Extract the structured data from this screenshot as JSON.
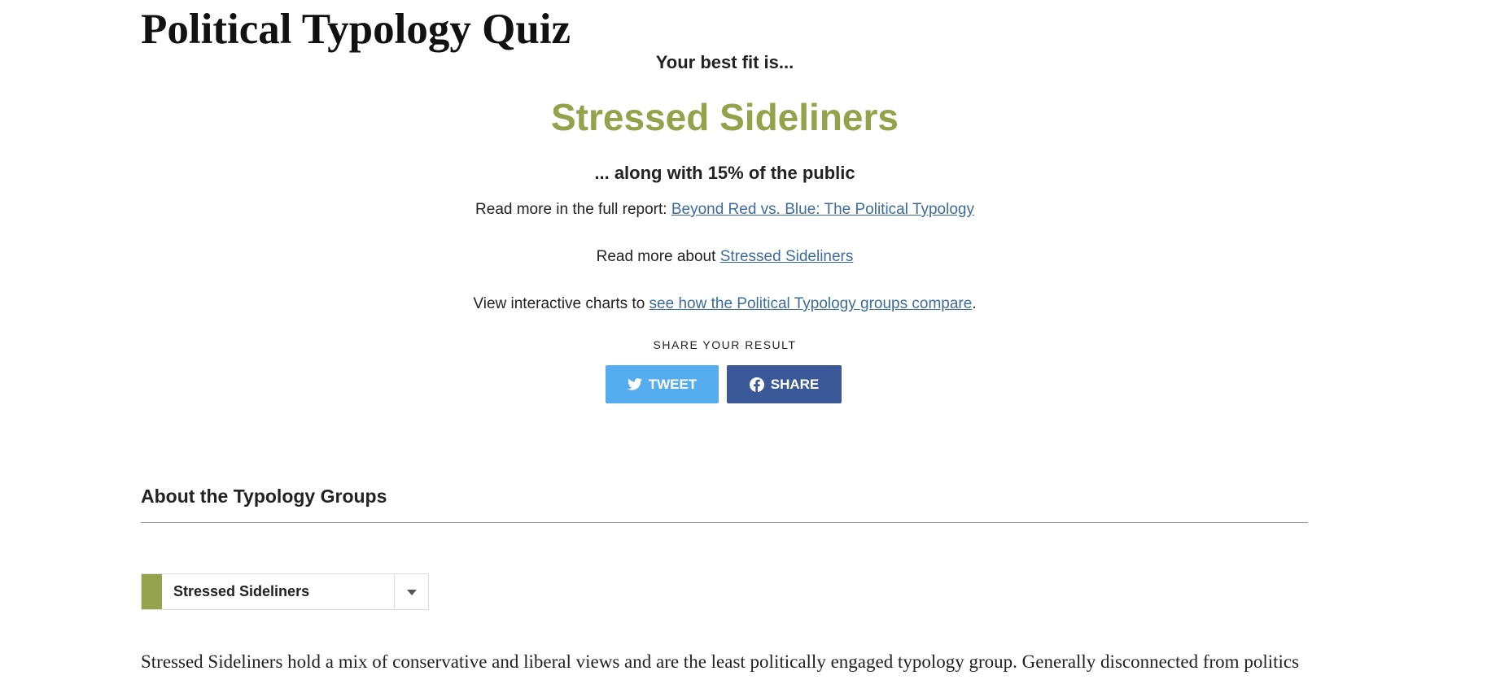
{
  "header": {
    "title": "Political Typology Quiz"
  },
  "result": {
    "intro": "Your best fit is...",
    "group_name": "Stressed Sideliners",
    "public_share": "... along with 15% of the public",
    "report_prefix": "Read more in the full report: ",
    "report_link": "Beyond Red vs. Blue: The Political Typology",
    "about_prefix": "Read more about ",
    "about_link": "Stressed Sideliners",
    "charts_prefix": "View interactive charts to ",
    "charts_link": "see how the Political Typology groups compare",
    "charts_suffix": "."
  },
  "share": {
    "label": "SHARE YOUR RESULT",
    "tweet_label": "TWEET",
    "tweet_icon": "twitter-icon",
    "share_label": "SHARE",
    "share_icon": "facebook-icon"
  },
  "about": {
    "heading": "About the Typology Groups",
    "selected_group": "Stressed Sideliners",
    "dropdown_icon": "chevron-down-icon",
    "description": "Stressed Sideliners hold a mix of conservative and liberal views and are the least politically engaged typology group. Generally disconnected from politics and the news, in recent elections they have been split closely between the two parties."
  },
  "colors": {
    "group_accent": "#94a24c",
    "link": "#3c6c9c",
    "tweet_button": "#55acee",
    "share_button": "#3b5998"
  }
}
